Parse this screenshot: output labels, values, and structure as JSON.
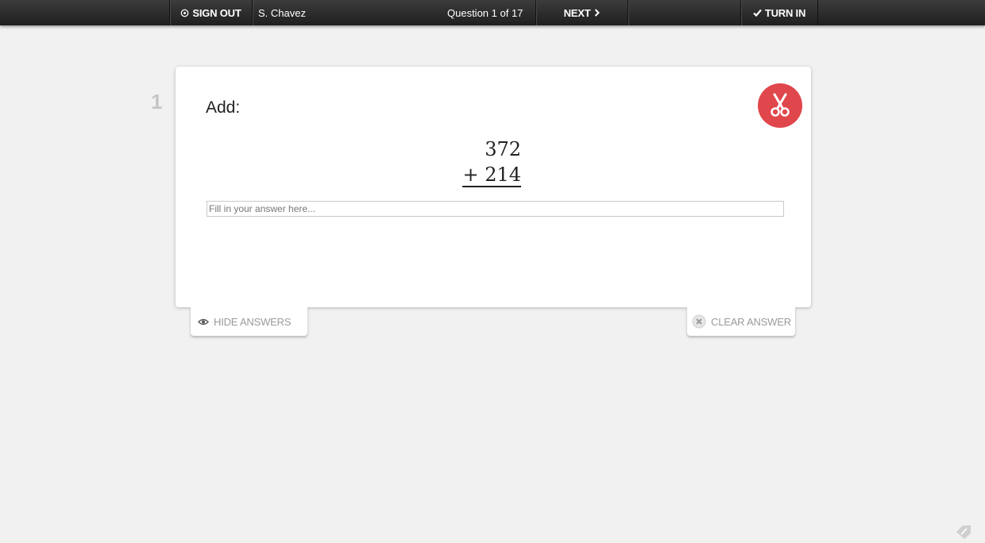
{
  "topbar": {
    "sign_out_label": "SIGN OUT",
    "student_name": "S. Chavez",
    "question_counter": "Question 1 of 17",
    "next_label": "NEXT",
    "turn_in_label": "TURN IN"
  },
  "question": {
    "number": "1",
    "prompt": "Add:",
    "addend_top": "372",
    "addend_bottom": "+ 214",
    "answer_value": "",
    "answer_placeholder": "Fill in your answer here..."
  },
  "controls": {
    "hide_answers_label": "HIDE ANSWERS",
    "clear_answer_label": "CLEAR ANSWER"
  },
  "colors": {
    "accent_red": "#e0474c",
    "topbar": "#2a2a2a",
    "background": "#f1f1f1"
  },
  "icons": {
    "sign_out": "power-icon",
    "next": "chevron-right-icon",
    "turn_in": "checkmark-icon",
    "cut": "scissors-icon",
    "hide": "eye-icon",
    "clear": "x-circle-icon",
    "corner": "pencil-tag-icon"
  }
}
